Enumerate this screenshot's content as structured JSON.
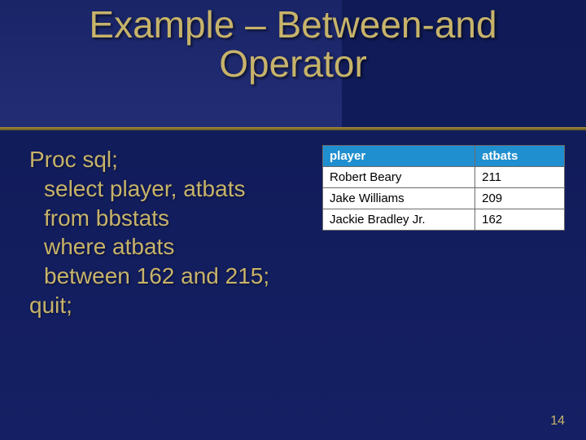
{
  "title_line1": "Example – Between-and",
  "title_line2": "Operator",
  "code": {
    "l1": "Proc sql;",
    "l2": "select player, atbats",
    "l3": "from bbstats",
    "l4": "where atbats",
    "l5": "between 162 and 215;",
    "l6": "quit;"
  },
  "table": {
    "headers": {
      "player": "player",
      "atbats": "atbats"
    },
    "rows": [
      {
        "player": "Robert Beary",
        "atbats": "211"
      },
      {
        "player": "Jake Williams",
        "atbats": "209"
      },
      {
        "player": "Jackie Bradley Jr.",
        "atbats": "162"
      }
    ]
  },
  "page_number": "14"
}
